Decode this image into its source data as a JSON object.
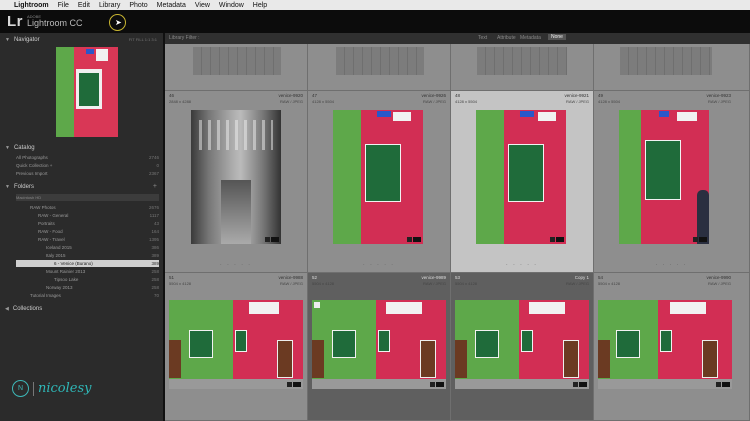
{
  "menubar": {
    "apple": "",
    "app_name": "Lightroom",
    "items": [
      "File",
      "Edit",
      "Library",
      "Photo",
      "Metadata",
      "View",
      "Window",
      "Help"
    ]
  },
  "identity_plate": {
    "logo": "Lr",
    "vendor": "ADOBE",
    "product": "Lightroom CC"
  },
  "left_panel": {
    "navigator": {
      "title": "Navigator"
    },
    "catalog": {
      "title": "Catalog",
      "items": [
        {
          "label": "All Photographs",
          "count": "2746"
        },
        {
          "label": "Quick Collection +",
          "count": "0"
        },
        {
          "label": "Previous Import",
          "count": "2367"
        }
      ]
    },
    "folders": {
      "title": "Folders",
      "drive": {
        "label": "Macintosh HD",
        "size": ""
      },
      "items": [
        {
          "label": "RAW Photos",
          "count": "2676"
        },
        {
          "label": "RAW - General",
          "count": "1117"
        },
        {
          "label": "Portraits",
          "count": "43"
        },
        {
          "label": "RAW - Food",
          "count": "164"
        },
        {
          "label": "RAW - Travel",
          "count": "1395"
        },
        {
          "label": "Iceland 2015",
          "count": "386"
        },
        {
          "label": "Italy 2015",
          "count": "389"
        },
        {
          "label": "6 - Venice (Burano)",
          "count": "389"
        },
        {
          "label": "Mount Rainier 2013",
          "count": "258"
        },
        {
          "label": "Tipsoo Lake",
          "count": "258"
        },
        {
          "label": "Norway 2013",
          "count": "258"
        },
        {
          "label": "Tutorial Images",
          "count": "70"
        }
      ],
      "selected_index": 7
    },
    "collections": {
      "title": "Collections"
    }
  },
  "branding": {
    "initials": "N",
    "word": "nicolesy"
  },
  "filter_bar": {
    "label": "Library Filter :",
    "tabs": [
      "Text",
      "Attribute",
      "Metadata",
      "None"
    ]
  },
  "grid": {
    "top_row": [
      {
        "num": "",
        "file": ""
      },
      {
        "num": "",
        "file": ""
      },
      {
        "num": "",
        "file": ""
      },
      {
        "num": "",
        "file": ""
      }
    ],
    "mid_row": [
      {
        "num": "46",
        "file": "venice-9920",
        "dims": "2848 x 4288",
        "ext": "RAW / JPEG"
      },
      {
        "num": "47",
        "file": "venice-9926",
        "dims": "4128 x 5504",
        "ext": "RAW / JPEG"
      },
      {
        "num": "48",
        "file": "venice-9921",
        "dims": "4128 x 5504",
        "ext": "RAW / JPEG"
      },
      {
        "num": "49",
        "file": "venice-9923",
        "dims": "4128 x 5504",
        "ext": "RAW / JPEG"
      }
    ],
    "bottom_row": [
      {
        "num": "51",
        "file": "venice-9988",
        "dims": "5504 x 4128",
        "ext": "RAW / JPEG"
      },
      {
        "num": "52",
        "file": "venice-9989",
        "dims": "5504 x 4128",
        "ext": "RAW / JPEG"
      },
      {
        "num": "53",
        "file": "Copy 1",
        "dims": "5504 x 4128",
        "ext": "RAW / JPEG"
      },
      {
        "num": "54",
        "file": "venice-9990",
        "dims": "5504 x 4128",
        "ext": "RAW / JPEG"
      }
    ],
    "stars": "· · · · ·",
    "selected_cell": "mid-2"
  }
}
